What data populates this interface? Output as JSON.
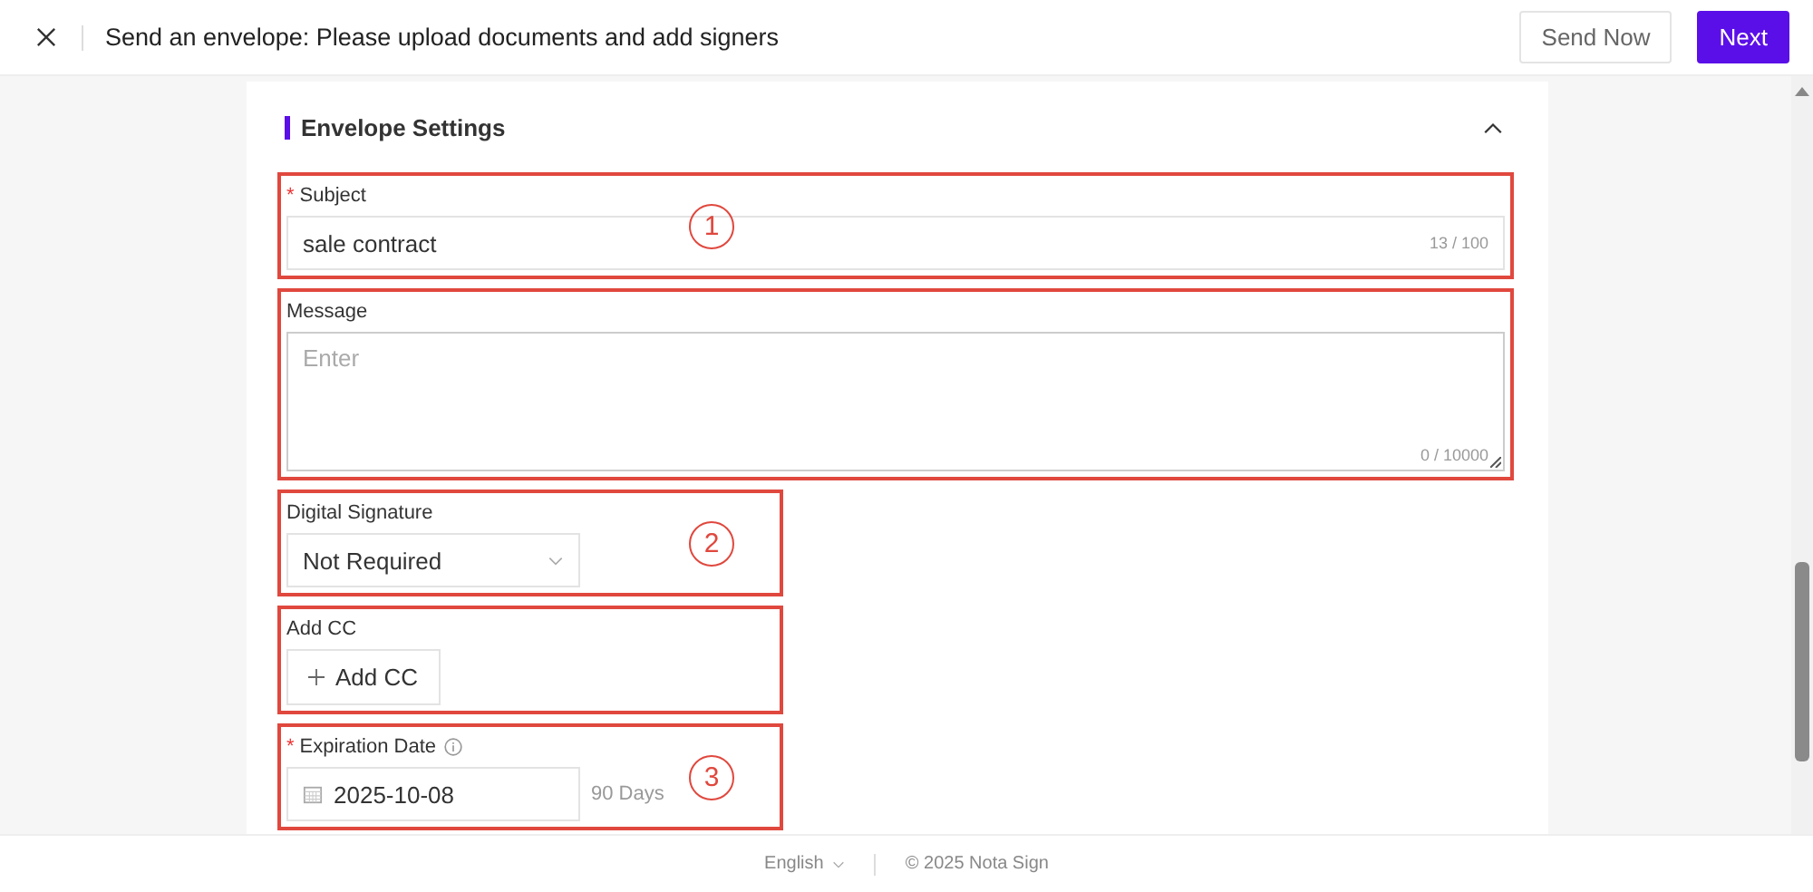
{
  "header": {
    "title": "Send an envelope: Please upload documents and add signers",
    "buttons": [
      {
        "label": "Send Now",
        "kind": "secondary"
      },
      {
        "label": "Next",
        "kind": "primary"
      }
    ]
  },
  "card": {
    "title": "Envelope Settings",
    "expanded": true,
    "fields": [
      {
        "kind": "text",
        "label": "Subject",
        "required_mark": "*",
        "value": "sale contract",
        "count": "13 / 100",
        "callout": "1"
      },
      {
        "kind": "textarea",
        "label": "Message",
        "placeholder": "Enter",
        "count": "0 / 10000"
      },
      {
        "kind": "select",
        "label": "Digital Signature",
        "value": "Not Required",
        "callout": "2"
      },
      {
        "kind": "add",
        "label": "Add CC",
        "button": "Add CC"
      },
      {
        "kind": "date",
        "label": "Expiration Date",
        "required_mark": "*",
        "info": true,
        "value": "2025-10-08",
        "note": "90 Days",
        "callout": "3"
      }
    ]
  },
  "footer": {
    "language": "English",
    "copyright": "© 2025 Nota Sign"
  }
}
